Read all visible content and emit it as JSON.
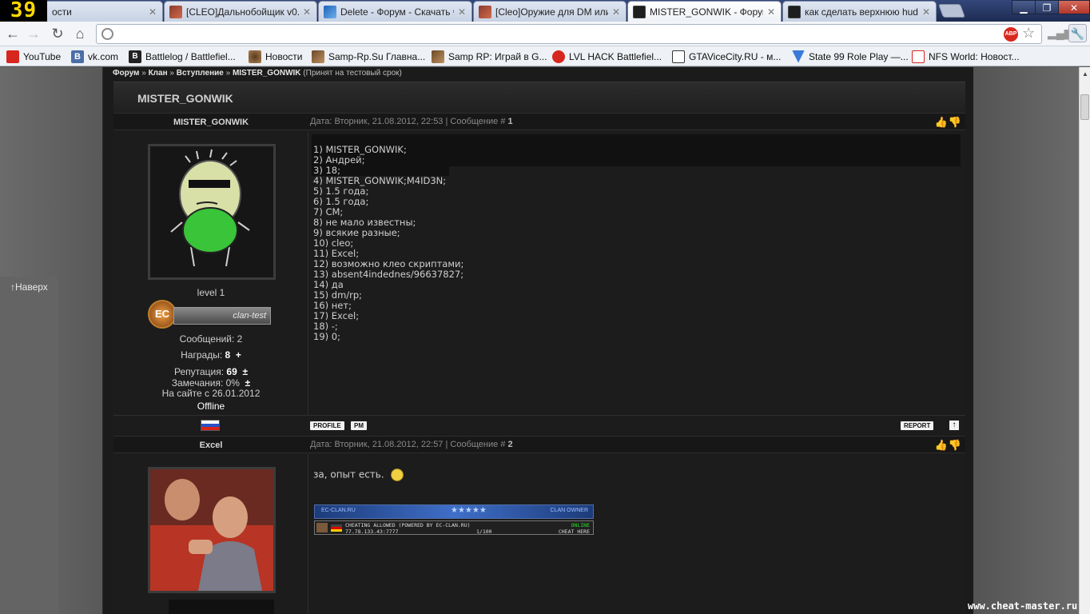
{
  "counter": "39",
  "tabs": [
    {
      "title": "ости",
      "icon": "news-icon"
    },
    {
      "title": "[CLEO]Дальнобойщик v0.3",
      "icon": "cleo-icon"
    },
    {
      "title": "Delete - Форум - Скачать ч",
      "icon": "forum-icon"
    },
    {
      "title": "[Cleo]Оружие для DM или",
      "icon": "cleo-icon"
    },
    {
      "title": "MISTER_GONWIK - Форум",
      "icon": "ec-icon"
    },
    {
      "title": "как сделать верхнюю hud",
      "icon": "ec-icon"
    }
  ],
  "window_buttons": {
    "minimize": "▁",
    "maximize": "❐",
    "close": "✕"
  },
  "address": {
    "value": ""
  },
  "bookmarks": [
    {
      "label": "YouTube"
    },
    {
      "label": "vk.com"
    },
    {
      "label": "Battlelog / Battlefiel..."
    },
    {
      "label": "Новости"
    },
    {
      "label": "Samp-Rp.Su Главна..."
    },
    {
      "label": "Samp RP: Играй в G..."
    },
    {
      "label": "LVL HACK Battlefiel..."
    },
    {
      "label": "GTAViceCity.RU - м..."
    },
    {
      "label": "State 99 Role Play —..."
    },
    {
      "label": "NFS World: Новост..."
    }
  ],
  "side": {
    "to_top": "↑Наверх"
  },
  "breadcrumb": {
    "forum": "Форум",
    "sep": "»",
    "clan": "Клан",
    "join": "Вступление",
    "thread": "MISTER_GONWIK",
    "note": "(Принят на тестовый срок)"
  },
  "thread_title": "MISTER_GONWIK",
  "posts": [
    {
      "author": "MISTER_GONWIK",
      "date": "Дата: Вторник, 21.08.2012, 22:53 | Сообщение #",
      "num": "1",
      "level": "level 1",
      "rank_badge": "EC",
      "rank_label": "clan-test",
      "messages": "Сообщений: 2",
      "awards_label": "Награды:",
      "awards": "8",
      "awards_plus": "+",
      "rep_label": "Репутация:",
      "rep": "69",
      "rep_pm": "±",
      "warnings": "Замечания: 0%",
      "warn_pm": "±",
      "since": "На сайте с 26.01.2012",
      "status": "Offline",
      "lines": [
        "1) MISTER_GONWIK;",
        "2) Андрей;",
        "3) 18;",
        "4) MISTER_GONWIK;M4ID3N;",
        "5) 1.5 года;",
        "6) 1.5 года;",
        "7) СМ;",
        "8) не мало известны;",
        "9) всякие разные;",
        "10) cleo;",
        "11) Excel;",
        "12) возможно клео скриптами;",
        "13) absent4indednes/96637827;",
        "14) да",
        "15) dm/rp;",
        "16) нет;",
        "17) Excel;",
        "18) -;",
        "19) 0;"
      ]
    },
    {
      "author": "Excel",
      "date": "Дата: Вторник, 21.08.2012, 22:57 | Сообщение #",
      "num": "2",
      "text": "за, опыт есть.",
      "sig1_left": "EC-CLAN.RU",
      "sig1_right": "CLAN OWNER",
      "sig2_left": "CHEATING ALLOWED (POWERED BY EC-CLAN.RU)",
      "sig2_ip": "77.78.133.43:7777",
      "sig2_players": "1/100",
      "sig2_status": "ONLINE",
      "sig2_cta": "CHEAT HERE"
    }
  ],
  "buttons": {
    "profile": "PROFILE",
    "pm": "PM",
    "report": "REPORT"
  },
  "watermark": "www.cheat-master.ru"
}
